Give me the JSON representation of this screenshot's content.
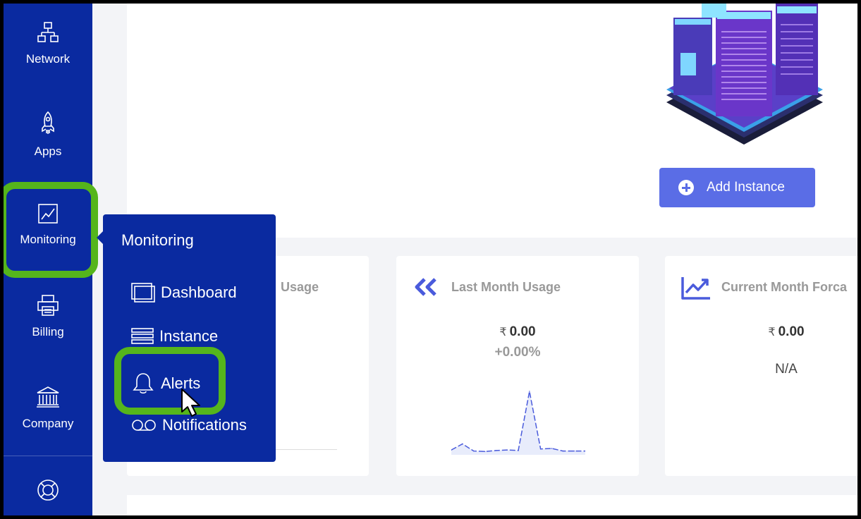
{
  "sidebar": {
    "items": [
      {
        "label": "Network",
        "icon": "network-icon"
      },
      {
        "label": "Apps",
        "icon": "rocket-icon"
      },
      {
        "label": "Monitoring",
        "icon": "chart-line-icon"
      },
      {
        "label": "Billing",
        "icon": "printer-icon"
      },
      {
        "label": "Company",
        "icon": "bank-icon"
      },
      {
        "label": "",
        "icon": "lifebuoy-icon"
      }
    ],
    "background": "#0a2aa0",
    "highlight_color": "#55b51c"
  },
  "top_panel": {
    "add_instance_label": "Add Instance",
    "button_color": "#5a6de6"
  },
  "cards": [
    {
      "title": "Usage"
    },
    {
      "title": "Last Month Usage",
      "currency": "₹",
      "amount": "0.00",
      "change": "+0.00%",
      "icon": "double-chevron-left-icon"
    },
    {
      "title": "Current Month Forca",
      "currency": "₹",
      "amount": "0.00",
      "status": "N/A",
      "icon": "trending-up-icon"
    }
  ],
  "monitoring_menu": {
    "title": "Monitoring",
    "items": [
      {
        "label": "Dashboard",
        "icon": "dashboard-icon"
      },
      {
        "label": "Instance",
        "icon": "instance-list-icon"
      },
      {
        "label": "Alerts",
        "icon": "bell-icon"
      },
      {
        "label": "Notifications",
        "icon": "voicemail-icon"
      }
    ]
  },
  "chart_data": {
    "type": "line",
    "values": [
      0.2,
      0.8,
      0.1,
      0.05,
      0.15,
      0.2,
      0.15,
      6.0,
      0.3,
      0.35,
      0.1,
      0.1,
      0.1
    ],
    "title": "",
    "xlabel": "",
    "ylabel": ""
  }
}
